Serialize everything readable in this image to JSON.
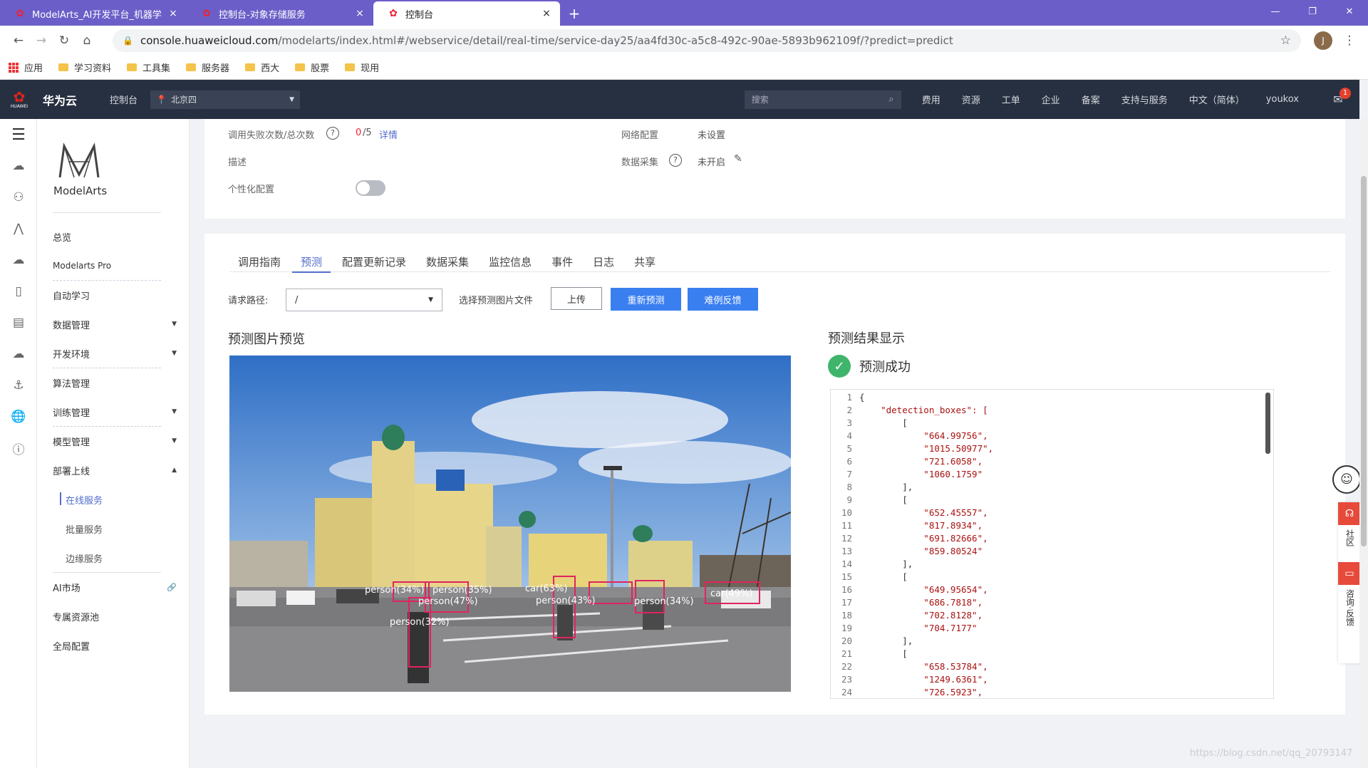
{
  "browser": {
    "tabs": [
      {
        "title": "ModelArts_AI开发平台_机器学",
        "close": "×"
      },
      {
        "title": "控制台-对象存储服务",
        "close": "×"
      },
      {
        "title": "控制台",
        "close": "×"
      }
    ],
    "new_tab": "+",
    "url_host": "console.huaweicloud.com",
    "url_path": "/modelarts/index.html#/webservice/detail/real-time/service-day25/aa4fd30c-a5c8-492c-90ae-5893b962109f/?predict=predict",
    "account_initial": "J",
    "bookmarks": [
      "应用",
      "学习资料",
      "工具集",
      "服务器",
      "西大",
      "股票",
      "现用"
    ]
  },
  "header": {
    "logo_text": "HUAWEI",
    "brand": "华为云",
    "console": "控制台",
    "region": "北京四",
    "search_placeholder": "搜索",
    "nav": [
      "费用",
      "资源",
      "工单",
      "企业",
      "备案",
      "支持与服务",
      "中文（简体）",
      "youkox"
    ],
    "mail_badge": "1"
  },
  "sidebar": {
    "app_name": "ModelArts",
    "items": [
      {
        "label": "总览"
      },
      {
        "label": "Modelarts Pro"
      },
      {
        "label": "自动学习"
      },
      {
        "label": "数据管理"
      },
      {
        "label": "开发环境"
      },
      {
        "label": "算法管理"
      },
      {
        "label": "训练管理"
      },
      {
        "label": "模型管理"
      },
      {
        "label": "部署上线"
      },
      {
        "label": "在线服务"
      },
      {
        "label": "批量服务"
      },
      {
        "label": "边缘服务"
      },
      {
        "label": "AI市场"
      },
      {
        "label": "专属资源池"
      },
      {
        "label": "全局配置"
      }
    ]
  },
  "info": {
    "fail_count_label": "调用失败次数/总次数",
    "fail_count_value": "0",
    "total_count_value": "/5",
    "detail_link": "详情",
    "network_label": "网络配置",
    "network_value": "未设置",
    "desc_label": "描述",
    "datacollect_label": "数据采集",
    "datacollect_value": "未开启",
    "personal_label": "个性化配置"
  },
  "predict": {
    "tabs": [
      "调用指南",
      "预测",
      "配置更新记录",
      "数据采集",
      "监控信息",
      "事件",
      "日志",
      "共享"
    ],
    "path_label": "请求路径:",
    "path_value": "/",
    "choose_file_label": "选择预测图片文件",
    "upload_btn": "上传",
    "repredict_btn": "重新预测",
    "feedback_btn": "难例反馈",
    "preview_title": "预测图片预览",
    "result_title": "预测结果显示",
    "success_text": "预测成功"
  },
  "detections": [
    "person(34%)",
    "person(35%)",
    "person(47%)",
    "person(32%)",
    "car(63%)",
    "person(43%)",
    "person(34%)",
    "car(49%)"
  ],
  "code_lines": [
    "{",
    "    \"detection_boxes\": [",
    "        [",
    "            \"664.99756\",",
    "            \"1015.50977\",",
    "            \"721.6058\",",
    "            \"1060.1759\"",
    "        ],",
    "        [",
    "            \"652.45557\",",
    "            \"817.8934\",",
    "            \"691.82666\",",
    "            \"859.80524\"",
    "        ],",
    "        [",
    "            \"649.95654\",",
    "            \"686.7818\",",
    "            \"702.8128\",",
    "            \"704.7177\"",
    "        ],",
    "        [",
    "            \"658.53784\",",
    "            \"1249.6361\",",
    "            \"726.5923\","
  ],
  "float": {
    "community": "社区",
    "consult": "咨询·反馈"
  },
  "watermark": "https://blog.csdn.net/qq_20793147",
  "colors": {
    "accent": "#526ecc",
    "header_bg": "#273041",
    "button_primary": "#3a7ff0",
    "success": "#3fb56b",
    "box": "#e0245e"
  }
}
